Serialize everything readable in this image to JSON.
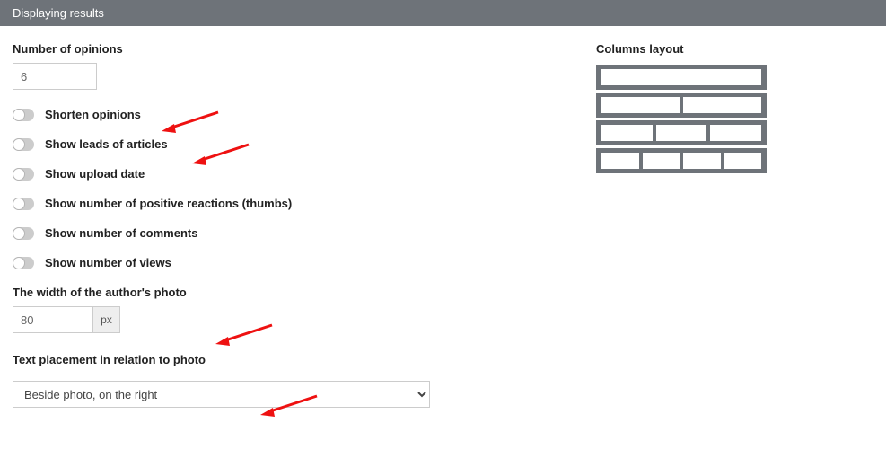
{
  "header": {
    "title": "Displaying results"
  },
  "opinions": {
    "count_label": "Number of opinions",
    "count_value": "6"
  },
  "toggles": [
    {
      "label": "Shorten opinions",
      "on": false
    },
    {
      "label": "Show leads of articles",
      "on": false
    },
    {
      "label": "Show upload date",
      "on": false
    },
    {
      "label": "Show number of positive reactions (thumbs)",
      "on": false
    },
    {
      "label": "Show number of comments",
      "on": false
    },
    {
      "label": "Show number of views",
      "on": false
    }
  ],
  "photo_width": {
    "label": "The width of the author's photo",
    "value": "80",
    "unit": "px"
  },
  "text_placement": {
    "label": "Text placement in relation to photo",
    "selected": "Beside photo, on the right"
  },
  "columns": {
    "label": "Columns layout",
    "rows": [
      1,
      2,
      3,
      4
    ]
  }
}
